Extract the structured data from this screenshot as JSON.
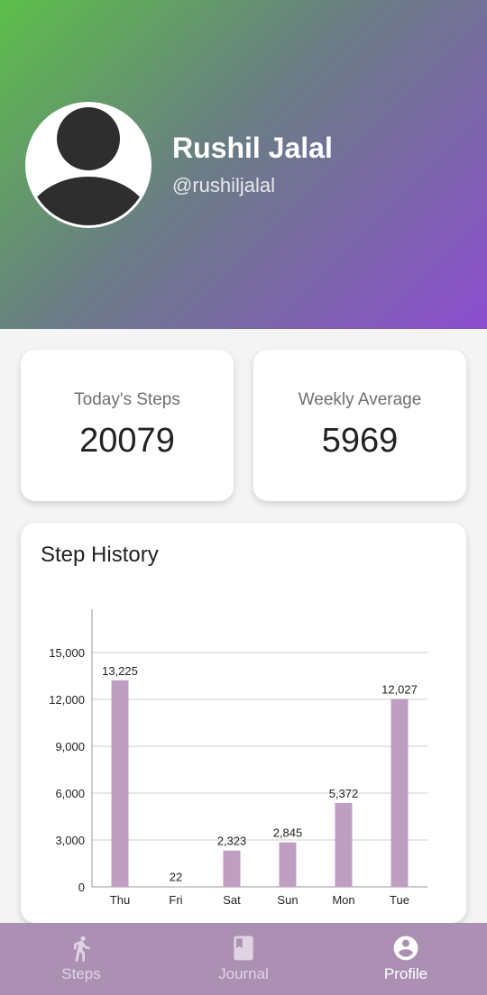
{
  "profile": {
    "name": "Rushil Jalal",
    "handle": "@rushiljalal"
  },
  "stats": {
    "today_label": "Today's Steps",
    "today_value": "20079",
    "weekly_label": "Weekly Average",
    "weekly_value": "5969"
  },
  "history": {
    "title": "Step History"
  },
  "chart_data": {
    "type": "bar",
    "categories": [
      "Thu",
      "Fri",
      "Sat",
      "Sun",
      "Mon",
      "Tue"
    ],
    "values": [
      13225,
      22,
      2323,
      2845,
      5372,
      12027
    ],
    "value_labels": [
      "13,225",
      "22",
      "2,323",
      "2,845",
      "5,372",
      "12,027"
    ],
    "ylim": [
      0,
      15000
    ],
    "yticks": [
      0,
      3000,
      6000,
      9000,
      12000,
      15000
    ],
    "ytick_labels": [
      "0",
      "3,000",
      "6,000",
      "9,000",
      "12,000",
      "15,000"
    ],
    "grid": true,
    "bar_color": "#bf9fc1",
    "title": "",
    "xlabel": "",
    "ylabel": ""
  },
  "nav": {
    "items": [
      {
        "label": "Steps",
        "icon": "walking-icon"
      },
      {
        "label": "Journal",
        "icon": "book-icon"
      },
      {
        "label": "Profile",
        "icon": "account-circle-icon"
      }
    ],
    "active_index": 2
  },
  "colors": {
    "gradient_start": "#5cbf49",
    "gradient_end": "#8d4ed0",
    "nav_background": "#ab90b4"
  }
}
